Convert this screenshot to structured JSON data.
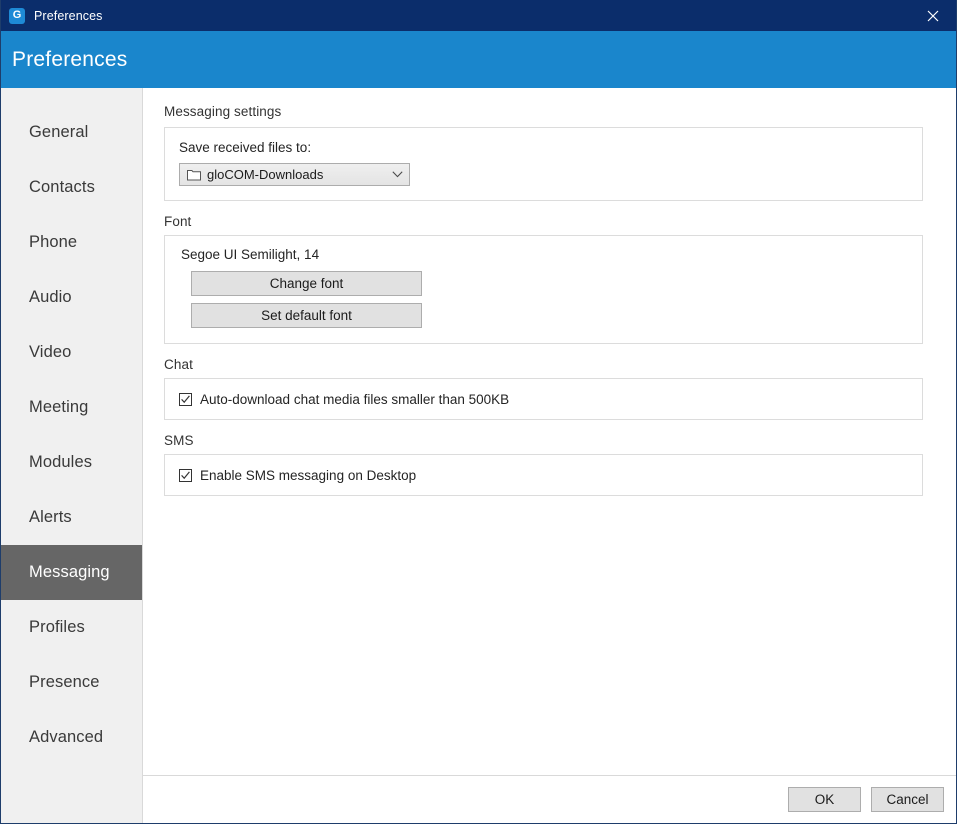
{
  "window": {
    "titlebar_title": "Preferences",
    "app_icon": "glocom-logo-icon",
    "app_icon_letter": "G",
    "close_icon": "close-icon",
    "colors": {
      "titlebar_bg": "#0b2d6b",
      "header_bg": "#1a86cc",
      "sidebar_bg": "#f0f0f0",
      "selected_nav_bg": "#666666",
      "content_bg": "#ffffff",
      "button_bg": "#e1e1e1",
      "group_border": "#dcdcdc"
    }
  },
  "header": {
    "title": "Preferences"
  },
  "sidebar": {
    "items": [
      {
        "label": "General",
        "selected": false
      },
      {
        "label": "Contacts",
        "selected": false
      },
      {
        "label": "Phone",
        "selected": false
      },
      {
        "label": "Audio",
        "selected": false
      },
      {
        "label": "Video",
        "selected": false
      },
      {
        "label": "Meeting",
        "selected": false
      },
      {
        "label": "Modules",
        "selected": false
      },
      {
        "label": "Alerts",
        "selected": false
      },
      {
        "label": "Messaging",
        "selected": true
      },
      {
        "label": "Profiles",
        "selected": false
      },
      {
        "label": "Presence",
        "selected": false
      },
      {
        "label": "Advanced",
        "selected": false
      }
    ]
  },
  "main": {
    "section_title": "Messaging settings",
    "save_dir": {
      "label": "Save received files to:",
      "combo_value": "gloCOM-Downloads",
      "folder_icon": "folder-icon",
      "chevron_icon": "chevron-down-icon"
    },
    "font": {
      "group_label": "Font",
      "preview_text": "Segoe UI Semilight, 14",
      "change_font_label": "Change font",
      "set_default_font_label": "Set default font"
    },
    "chat": {
      "group_label": "Chat",
      "auto_download_label": "Auto-download chat media files smaller than 500KB",
      "auto_download_checked": true
    },
    "sms": {
      "group_label": "SMS",
      "enable_sms_label": "Enable SMS messaging on Desktop",
      "enable_sms_checked": true
    }
  },
  "footer": {
    "ok_label": "OK",
    "cancel_label": "Cancel"
  }
}
